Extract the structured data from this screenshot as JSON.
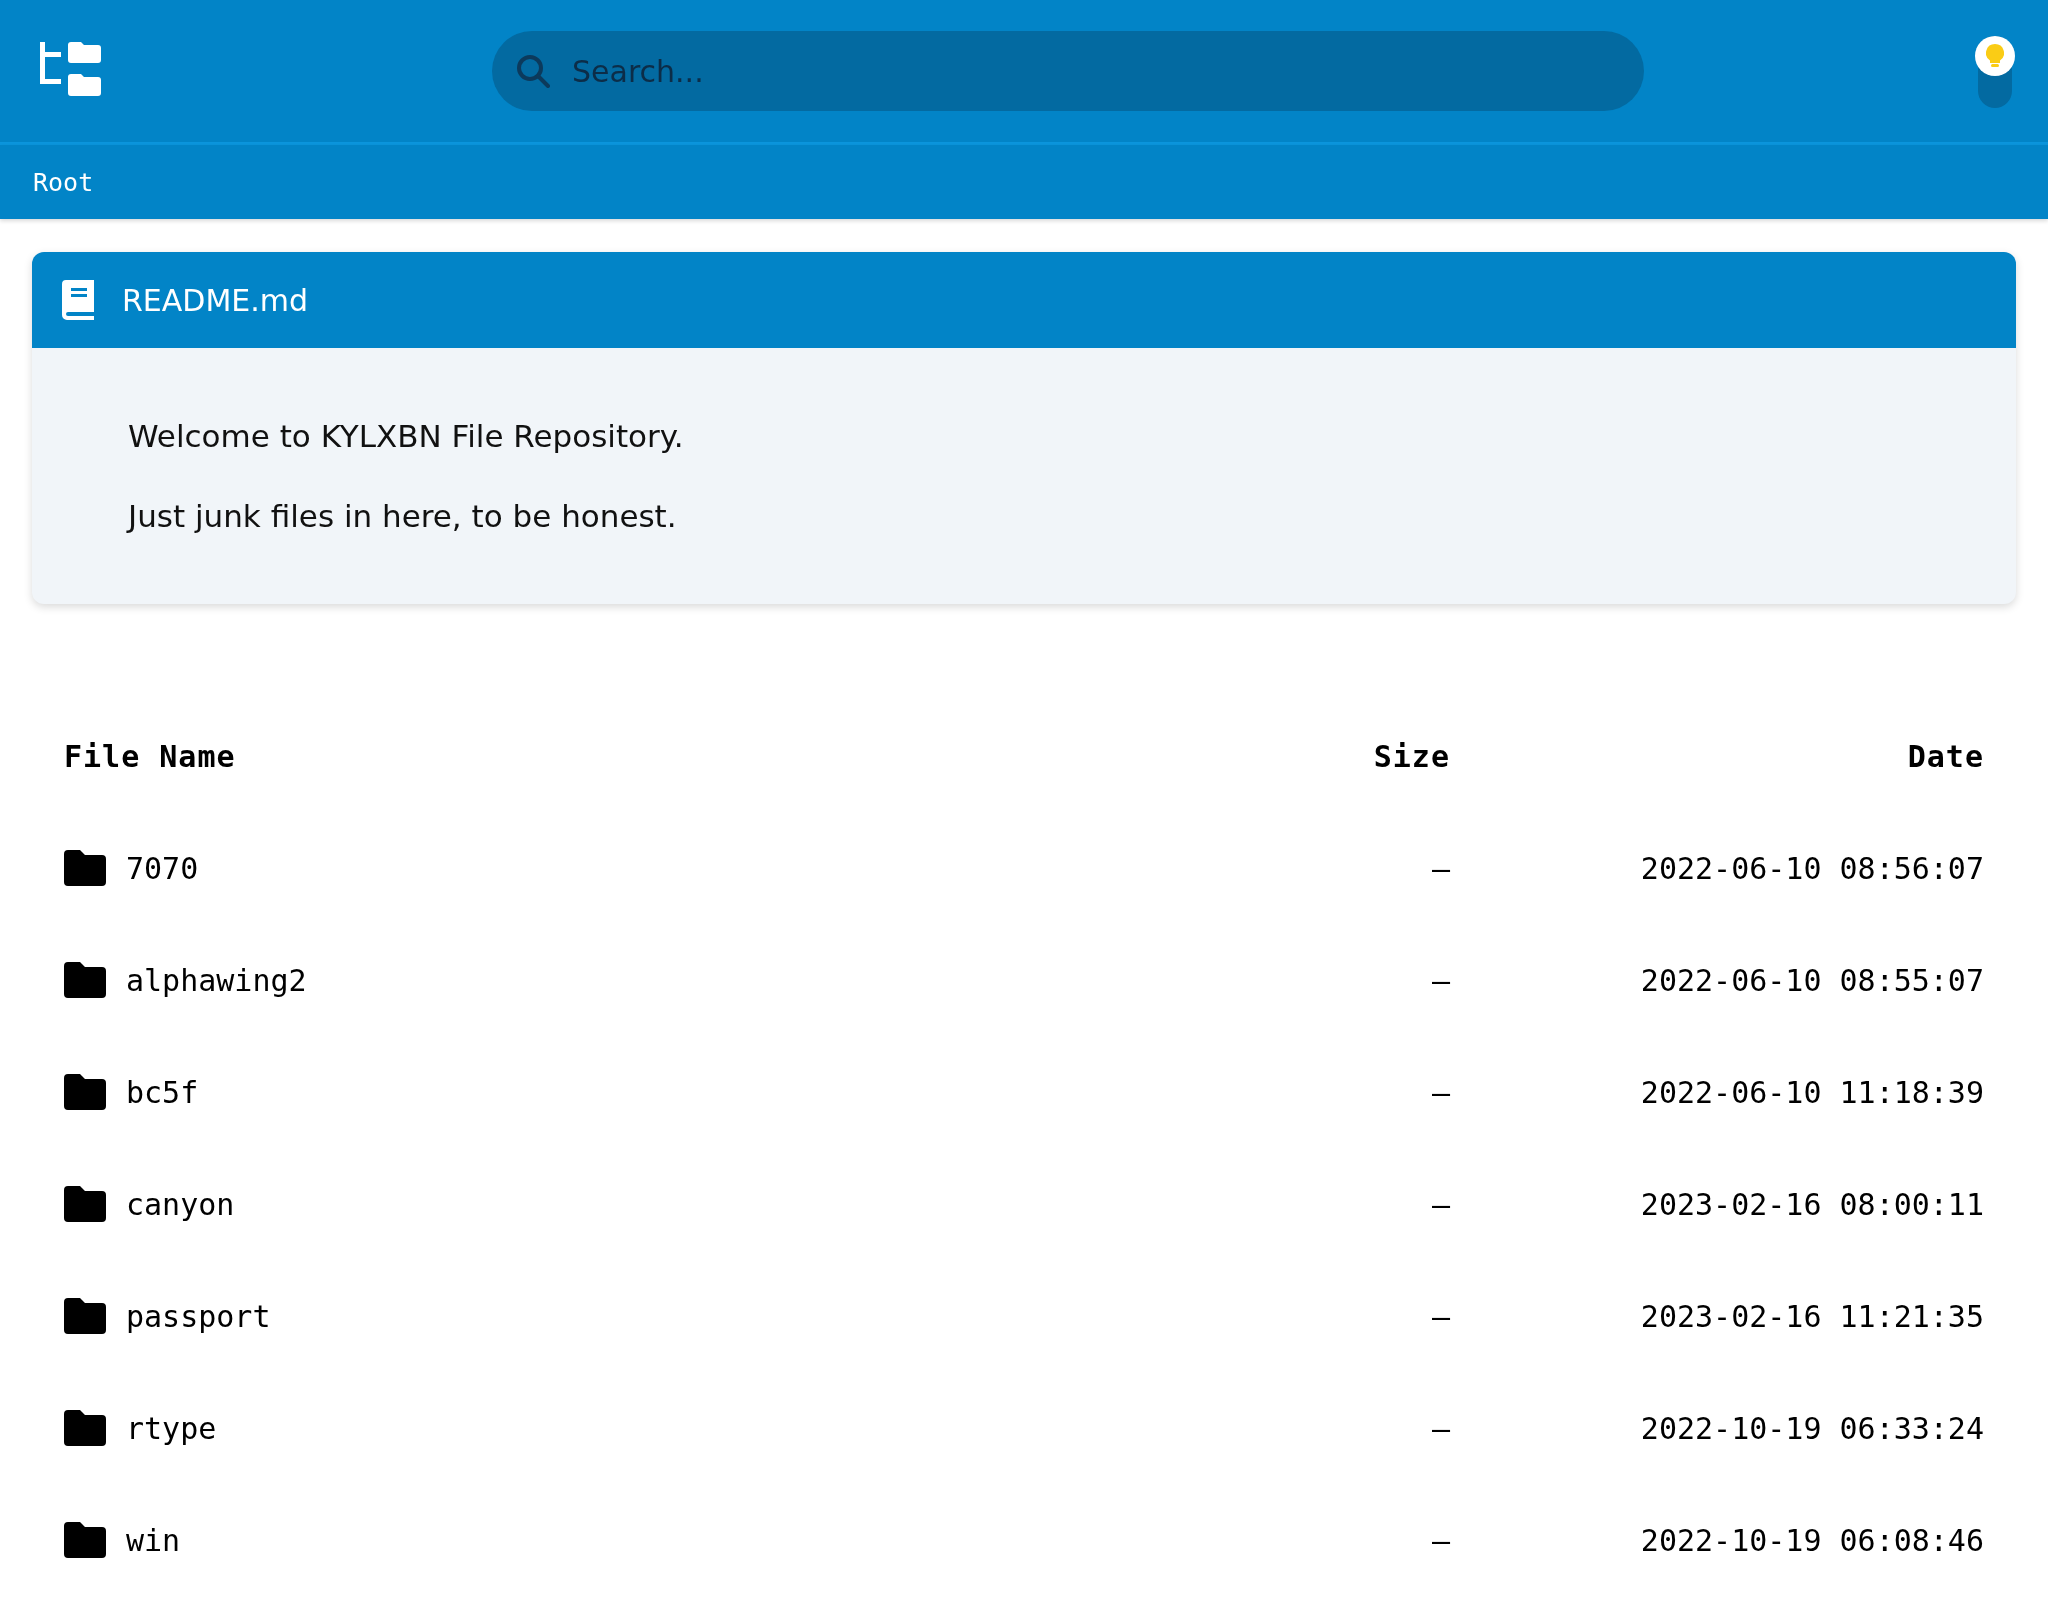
{
  "header": {
    "search": {
      "placeholder": "Search..."
    },
    "theme_toggle": {
      "dark_mode": false
    }
  },
  "breadcrumb": [
    "Root"
  ],
  "readme": {
    "title": "README.md",
    "paragraphs": [
      "Welcome to KYLXBN File Repository.",
      "Just junk files in here, to be honest."
    ]
  },
  "table": {
    "columns": [
      "File Name",
      "Size",
      "Date"
    ],
    "rows": [
      {
        "kind": "folder",
        "name": "7070",
        "size": "—",
        "date": "2022-06-10 08:56:07"
      },
      {
        "kind": "folder",
        "name": "alphawing2",
        "size": "—",
        "date": "2022-06-10 08:55:07"
      },
      {
        "kind": "folder",
        "name": "bc5f",
        "size": "—",
        "date": "2022-06-10 11:18:39"
      },
      {
        "kind": "folder",
        "name": "canyon",
        "size": "—",
        "date": "2023-02-16 08:00:11"
      },
      {
        "kind": "folder",
        "name": "passport",
        "size": "—",
        "date": "2023-02-16 11:21:35"
      },
      {
        "kind": "folder",
        "name": "rtype",
        "size": "—",
        "date": "2022-10-19 06:33:24"
      },
      {
        "kind": "folder",
        "name": "win",
        "size": "—",
        "date": "2022-10-19 06:08:46"
      }
    ]
  }
}
